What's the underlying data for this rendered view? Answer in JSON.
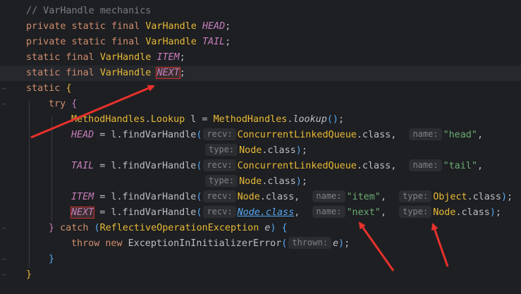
{
  "editor": {
    "language": "java",
    "lines": [
      {
        "tokens": [
          [
            "cm",
            "// VarHandle mechanics"
          ]
        ]
      },
      {
        "tokens": [
          [
            "k",
            "private static final "
          ],
          [
            "ty",
            "VarHandle "
          ],
          [
            "st",
            "HEAD"
          ],
          [
            "fn",
            ";"
          ]
        ]
      },
      {
        "tokens": [
          [
            "k",
            "private static final "
          ],
          [
            "ty",
            "VarHandle "
          ],
          [
            "st",
            "TAIL"
          ],
          [
            "fn",
            ";"
          ]
        ]
      },
      {
        "tokens": [
          [
            "k",
            "static final "
          ],
          [
            "ty",
            "VarHandle "
          ],
          [
            "st",
            "ITEM"
          ],
          [
            "fn",
            ";"
          ]
        ]
      },
      {
        "tokens": [
          [
            "k",
            "static final "
          ],
          [
            "ty",
            "VarHandle "
          ],
          [
            "hlst",
            "NEXT"
          ],
          [
            "fn",
            ";"
          ]
        ]
      },
      {
        "tokens": [
          [
            "k",
            "static "
          ],
          [
            "br-y",
            "{"
          ]
        ]
      },
      {
        "tokens": [
          [
            "k",
            "try "
          ],
          [
            "br-p",
            "{"
          ]
        ]
      },
      {
        "tokens": [
          [
            "ty",
            "MethodHandles"
          ],
          [
            "fn",
            "."
          ],
          [
            "ty",
            "Lookup"
          ],
          [
            "fn",
            " l = "
          ],
          [
            "ty",
            "MethodHandles"
          ],
          [
            "fn",
            "."
          ],
          [
            "it",
            "lookup"
          ],
          [
            "br-b",
            "()"
          ],
          [
            "fn",
            ";"
          ]
        ]
      },
      {
        "tokens": [
          [
            "st",
            "HEAD"
          ],
          [
            "fn",
            " = l.findVarHandle"
          ],
          [
            "br-b",
            "("
          ],
          [
            "hint",
            "recv:"
          ],
          [
            "ty",
            "ConcurrentLinkedQueue"
          ],
          [
            "fn",
            ".class,  "
          ],
          [
            "hint",
            "name:"
          ],
          [
            "sg",
            "\"head\""
          ],
          [
            "fn",
            ","
          ]
        ]
      },
      {
        "tokens": [
          [
            "hint",
            "type:"
          ],
          [
            "ty",
            "Node"
          ],
          [
            "fn",
            ".class"
          ],
          [
            "br-b",
            ")"
          ],
          [
            "fn",
            ";"
          ]
        ]
      },
      {
        "tokens": [
          [
            "st",
            "TAIL"
          ],
          [
            "fn",
            " = l.findVarHandle"
          ],
          [
            "br-b",
            "("
          ],
          [
            "hint",
            "recv:"
          ],
          [
            "ty",
            "ConcurrentLinkedQueue"
          ],
          [
            "fn",
            ".class,  "
          ],
          [
            "hint",
            "name:"
          ],
          [
            "sg",
            "\"tail\""
          ],
          [
            "fn",
            ","
          ]
        ]
      },
      {
        "tokens": [
          [
            "hint",
            "type:"
          ],
          [
            "ty",
            "Node"
          ],
          [
            "fn",
            ".class"
          ],
          [
            "br-b",
            ")"
          ],
          [
            "fn",
            ";"
          ]
        ]
      },
      {
        "tokens": [
          [
            "st",
            "ITEM"
          ],
          [
            "fn",
            " = l.findVarHandle"
          ],
          [
            "br-b",
            "("
          ],
          [
            "hint",
            "recv:"
          ],
          [
            "ty",
            "Node"
          ],
          [
            "fn",
            ".class,  "
          ],
          [
            "hint",
            "name:"
          ],
          [
            "sg",
            "\"item\""
          ],
          [
            "fn",
            ",  "
          ],
          [
            "hint",
            "type:"
          ],
          [
            "ty",
            "Object"
          ],
          [
            "fn",
            ".class"
          ],
          [
            "br-b",
            ")"
          ],
          [
            "fn",
            ";"
          ]
        ]
      },
      {
        "tokens": [
          [
            "hlst",
            "NEXT"
          ],
          [
            "fn",
            " = l.findVarHandle"
          ],
          [
            "br-b",
            "("
          ],
          [
            "hint",
            "recv:"
          ],
          [
            "link",
            "Node.class"
          ],
          [
            "fn",
            ",  "
          ],
          [
            "hint",
            "name:"
          ],
          [
            "sg",
            "\"next\""
          ],
          [
            "fn",
            ",  "
          ],
          [
            "hint",
            "type:"
          ],
          [
            "ty",
            "Node"
          ],
          [
            "fn",
            ".class"
          ],
          [
            "br-b",
            ")"
          ],
          [
            "fn",
            ";"
          ]
        ]
      },
      {
        "tokens": [
          [
            "br-p",
            "} "
          ],
          [
            "k",
            "catch "
          ],
          [
            "br-b",
            "("
          ],
          [
            "ty",
            "ReflectiveOperationException"
          ],
          [
            "fn",
            " "
          ],
          [
            "pm",
            "e"
          ],
          [
            "br-b",
            ") "
          ],
          [
            "br-b",
            "{"
          ]
        ]
      },
      {
        "tokens": [
          [
            "k",
            "throw new "
          ],
          [
            "fn",
            "ExceptionInInitializerError"
          ],
          [
            "br-b",
            "("
          ],
          [
            "hint",
            "thrown:"
          ],
          [
            "pm",
            "e"
          ],
          [
            "br-b",
            ")"
          ],
          [
            "fn",
            ";"
          ]
        ]
      },
      {
        "tokens": [
          [
            "br-b",
            "}"
          ]
        ]
      },
      {
        "tokens": [
          [
            "br-y",
            "}"
          ]
        ]
      }
    ]
  },
  "colors": {
    "background": "#1e1f22",
    "annotation_arrow": "#e8312c"
  }
}
